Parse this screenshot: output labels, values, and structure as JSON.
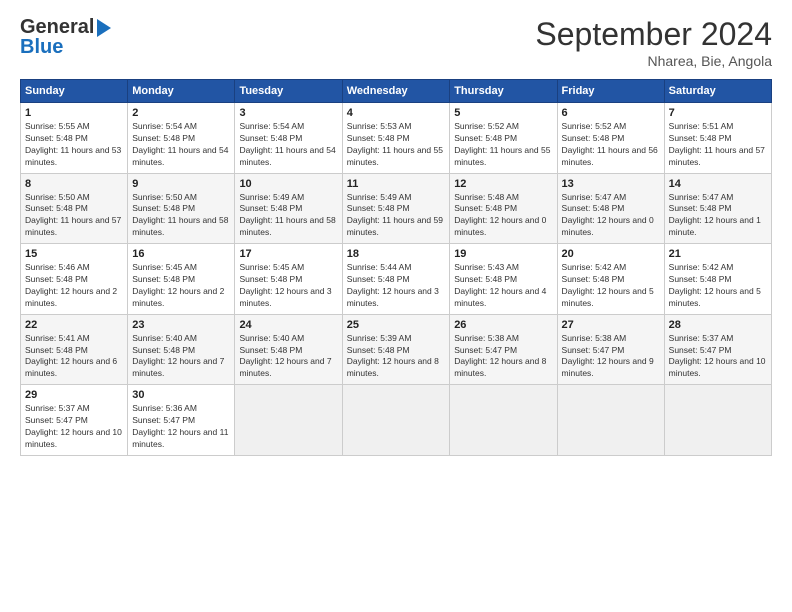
{
  "header": {
    "logo_line1": "General",
    "logo_line2": "Blue",
    "month": "September 2024",
    "location": "Nharea, Bie, Angola"
  },
  "weekdays": [
    "Sunday",
    "Monday",
    "Tuesday",
    "Wednesday",
    "Thursday",
    "Friday",
    "Saturday"
  ],
  "weeks": [
    [
      {
        "day": "1",
        "sunrise": "5:55 AM",
        "sunset": "5:48 PM",
        "daylight": "11 hours and 53 minutes."
      },
      {
        "day": "2",
        "sunrise": "5:54 AM",
        "sunset": "5:48 PM",
        "daylight": "11 hours and 54 minutes."
      },
      {
        "day": "3",
        "sunrise": "5:54 AM",
        "sunset": "5:48 PM",
        "daylight": "11 hours and 54 minutes."
      },
      {
        "day": "4",
        "sunrise": "5:53 AM",
        "sunset": "5:48 PM",
        "daylight": "11 hours and 55 minutes."
      },
      {
        "day": "5",
        "sunrise": "5:52 AM",
        "sunset": "5:48 PM",
        "daylight": "11 hours and 55 minutes."
      },
      {
        "day": "6",
        "sunrise": "5:52 AM",
        "sunset": "5:48 PM",
        "daylight": "11 hours and 56 minutes."
      },
      {
        "day": "7",
        "sunrise": "5:51 AM",
        "sunset": "5:48 PM",
        "daylight": "11 hours and 57 minutes."
      }
    ],
    [
      {
        "day": "8",
        "sunrise": "5:50 AM",
        "sunset": "5:48 PM",
        "daylight": "11 hours and 57 minutes."
      },
      {
        "day": "9",
        "sunrise": "5:50 AM",
        "sunset": "5:48 PM",
        "daylight": "11 hours and 58 minutes."
      },
      {
        "day": "10",
        "sunrise": "5:49 AM",
        "sunset": "5:48 PM",
        "daylight": "11 hours and 58 minutes."
      },
      {
        "day": "11",
        "sunrise": "5:49 AM",
        "sunset": "5:48 PM",
        "daylight": "11 hours and 59 minutes."
      },
      {
        "day": "12",
        "sunrise": "5:48 AM",
        "sunset": "5:48 PM",
        "daylight": "12 hours and 0 minutes."
      },
      {
        "day": "13",
        "sunrise": "5:47 AM",
        "sunset": "5:48 PM",
        "daylight": "12 hours and 0 minutes."
      },
      {
        "day": "14",
        "sunrise": "5:47 AM",
        "sunset": "5:48 PM",
        "daylight": "12 hours and 1 minute."
      }
    ],
    [
      {
        "day": "15",
        "sunrise": "5:46 AM",
        "sunset": "5:48 PM",
        "daylight": "12 hours and 2 minutes."
      },
      {
        "day": "16",
        "sunrise": "5:45 AM",
        "sunset": "5:48 PM",
        "daylight": "12 hours and 2 minutes."
      },
      {
        "day": "17",
        "sunrise": "5:45 AM",
        "sunset": "5:48 PM",
        "daylight": "12 hours and 3 minutes."
      },
      {
        "day": "18",
        "sunrise": "5:44 AM",
        "sunset": "5:48 PM",
        "daylight": "12 hours and 3 minutes."
      },
      {
        "day": "19",
        "sunrise": "5:43 AM",
        "sunset": "5:48 PM",
        "daylight": "12 hours and 4 minutes."
      },
      {
        "day": "20",
        "sunrise": "5:42 AM",
        "sunset": "5:48 PM",
        "daylight": "12 hours and 5 minutes."
      },
      {
        "day": "21",
        "sunrise": "5:42 AM",
        "sunset": "5:48 PM",
        "daylight": "12 hours and 5 minutes."
      }
    ],
    [
      {
        "day": "22",
        "sunrise": "5:41 AM",
        "sunset": "5:48 PM",
        "daylight": "12 hours and 6 minutes."
      },
      {
        "day": "23",
        "sunrise": "5:40 AM",
        "sunset": "5:48 PM",
        "daylight": "12 hours and 7 minutes."
      },
      {
        "day": "24",
        "sunrise": "5:40 AM",
        "sunset": "5:48 PM",
        "daylight": "12 hours and 7 minutes."
      },
      {
        "day": "25",
        "sunrise": "5:39 AM",
        "sunset": "5:48 PM",
        "daylight": "12 hours and 8 minutes."
      },
      {
        "day": "26",
        "sunrise": "5:38 AM",
        "sunset": "5:47 PM",
        "daylight": "12 hours and 8 minutes."
      },
      {
        "day": "27",
        "sunrise": "5:38 AM",
        "sunset": "5:47 PM",
        "daylight": "12 hours and 9 minutes."
      },
      {
        "day": "28",
        "sunrise": "5:37 AM",
        "sunset": "5:47 PM",
        "daylight": "12 hours and 10 minutes."
      }
    ],
    [
      {
        "day": "29",
        "sunrise": "5:37 AM",
        "sunset": "5:47 PM",
        "daylight": "12 hours and 10 minutes."
      },
      {
        "day": "30",
        "sunrise": "5:36 AM",
        "sunset": "5:47 PM",
        "daylight": "12 hours and 11 minutes."
      },
      null,
      null,
      null,
      null,
      null
    ]
  ]
}
